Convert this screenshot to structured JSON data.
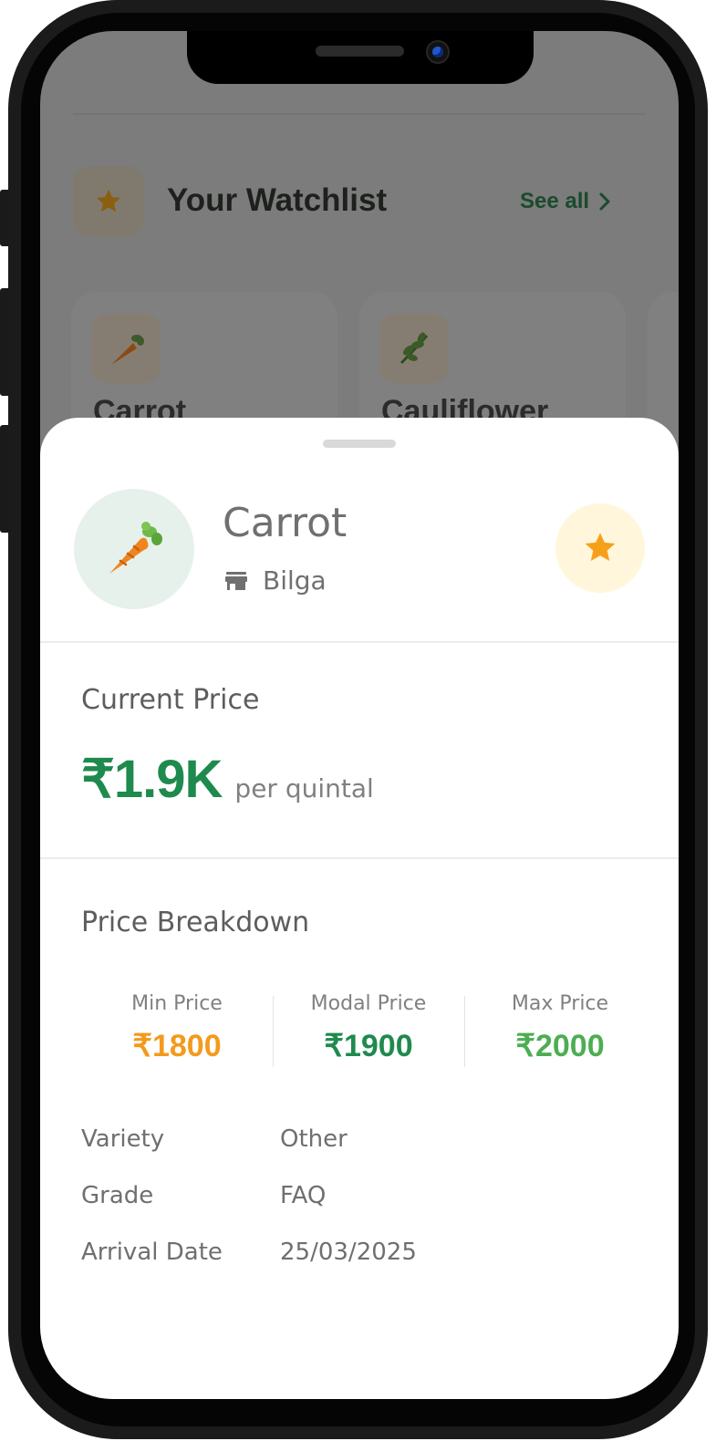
{
  "watchlist": {
    "title": "Your Watchlist",
    "see_all": "See all",
    "cards": [
      {
        "name": "Carrot",
        "icon": "carrot-icon"
      },
      {
        "name": "Cauliflower",
        "icon": "leaf-icon"
      }
    ]
  },
  "sheet": {
    "produce_name": "Carrot",
    "market": "Bilga",
    "current_price_title": "Current Price",
    "current_price": "₹1.9K",
    "price_unit": "per quintal",
    "breakdown_title": "Price Breakdown",
    "breakdown": [
      {
        "label": "Min Price",
        "value": "₹1800",
        "color": "#f39a1d"
      },
      {
        "label": "Modal Price",
        "value": "₹1900",
        "color": "#1f8a4d"
      },
      {
        "label": "Max Price",
        "value": "₹2000",
        "color": "#4cae52"
      }
    ],
    "details": [
      {
        "label": "Variety",
        "value": "Other"
      },
      {
        "label": "Grade",
        "value": "FAQ"
      },
      {
        "label": "Arrival Date",
        "value": "25/03/2025"
      }
    ]
  },
  "colors": {
    "accent_green": "#1f8a4d",
    "star_orange": "#f6a019",
    "star_bg": "#fff6dc",
    "avatar_bg": "#e7f1ec"
  }
}
